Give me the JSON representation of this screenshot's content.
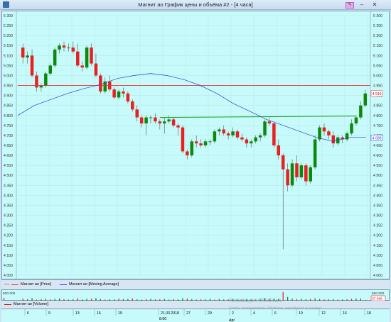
{
  "window": {
    "title": "Магнит ао График цены и объёма #2 - [4 часа]"
  },
  "price_axis": {
    "ticks": [
      "5 300",
      "5 250",
      "5 200",
      "5 150",
      "5 100",
      "5 050",
      "5 000",
      "4 950",
      "4 900",
      "4 850",
      "4 800",
      "4 750",
      "4 700",
      "4 650",
      "4 600",
      "4 550",
      "4 500",
      "4 450",
      "4 400",
      "4 350",
      "4 300",
      "4 250",
      "4 200",
      "4 150",
      "4 100",
      "4 050",
      "4 000"
    ],
    "last_price_label": "4 910",
    "ma_label": "4 688"
  },
  "volume_axis": {
    "top_label": "500 000",
    "bottom_label": "0",
    "last_volume_label": "37 488"
  },
  "legend": {
    "price": "Магнит ао [Price]",
    "ma": "Магнит ао [Moving Average]",
    "volume": "Магнит ао [Volume]"
  },
  "time_axis": {
    "labels": [
      "6",
      "9",
      "13",
      "16",
      "19",
      "21.03.2018",
      "8:00",
      "27",
      "29",
      "2",
      "4",
      "6",
      "10",
      "12",
      "16",
      "18"
    ],
    "month": "Apr"
  },
  "watermark": {
    "line1": "Активация Windows",
    "line2": "Чтобы активировать Windows, перейдите в раздел"
  },
  "chart_data": {
    "type": "candlestick",
    "ylim": [
      4000,
      5300
    ],
    "candles": [
      [
        5140,
        5160,
        5060,
        5090
      ],
      [
        5090,
        5120,
        5060,
        5100
      ],
      [
        5100,
        5130,
        4990,
        5000
      ],
      [
        5000,
        5020,
        4920,
        4940
      ],
      [
        4940,
        4960,
        4920,
        4950
      ],
      [
        4950,
        5020,
        4940,
        5010
      ],
      [
        5010,
        5060,
        5000,
        5050
      ],
      [
        5050,
        5140,
        5040,
        5130
      ],
      [
        5130,
        5160,
        5110,
        5150
      ],
      [
        5150,
        5170,
        5120,
        5140
      ],
      [
        5140,
        5160,
        5120,
        5140
      ],
      [
        5140,
        5170,
        5110,
        5120
      ],
      [
        5120,
        5160,
        5040,
        5050
      ],
      [
        5050,
        5070,
        5020,
        5040
      ],
      [
        5040,
        5150,
        5030,
        5140
      ],
      [
        5140,
        5160,
        5050,
        5060
      ],
      [
        5060,
        5110,
        4990,
        5000
      ],
      [
        5000,
        5010,
        4910,
        4920
      ],
      [
        4920,
        4990,
        4910,
        4970
      ],
      [
        4970,
        5000,
        4920,
        4930
      ],
      [
        4930,
        4940,
        4880,
        4890
      ],
      [
        4890,
        4930,
        4880,
        4920
      ],
      [
        4920,
        4940,
        4890,
        4910
      ],
      [
        4910,
        4920,
        4860,
        4870
      ],
      [
        4870,
        4880,
        4820,
        4830
      ],
      [
        4830,
        4850,
        4770,
        4790
      ],
      [
        4790,
        4800,
        4740,
        4760
      ],
      [
        4760,
        4800,
        4700,
        4790
      ],
      [
        4790,
        4800,
        4760,
        4790
      ],
      [
        4790,
        4810,
        4760,
        4770
      ],
      [
        4770,
        4780,
        4730,
        4760
      ],
      [
        4760,
        4790,
        4710,
        4770
      ],
      [
        4770,
        4800,
        4760,
        4780
      ],
      [
        4780,
        4790,
        4740,
        4750
      ],
      [
        4750,
        4760,
        4700,
        4740
      ],
      [
        4740,
        4750,
        4610,
        4620
      ],
      [
        4620,
        4630,
        4580,
        4600
      ],
      [
        4600,
        4680,
        4590,
        4670
      ],
      [
        4670,
        4700,
        4640,
        4660
      ],
      [
        4660,
        4680,
        4640,
        4650
      ],
      [
        4650,
        4680,
        4640,
        4670
      ],
      [
        4670,
        4680,
        4650,
        4670
      ],
      [
        4670,
        4730,
        4660,
        4720
      ],
      [
        4720,
        4740,
        4700,
        4730
      ],
      [
        4730,
        4750,
        4700,
        4710
      ],
      [
        4710,
        4720,
        4680,
        4700
      ],
      [
        4700,
        4740,
        4690,
        4720
      ],
      [
        4720,
        4730,
        4680,
        4690
      ],
      [
        4690,
        4710,
        4670,
        4680
      ],
      [
        4680,
        4690,
        4640,
        4660
      ],
      [
        4660,
        4680,
        4640,
        4670
      ],
      [
        4670,
        4700,
        4660,
        4690
      ],
      [
        4690,
        4710,
        4670,
        4700
      ],
      [
        4700,
        4780,
        4690,
        4770
      ],
      [
        4770,
        4790,
        4750,
        4760
      ],
      [
        4760,
        4770,
        4640,
        4650
      ],
      [
        4650,
        4680,
        4580,
        4600
      ],
      [
        4600,
        4610,
        4130,
        4530
      ],
      [
        4530,
        4560,
        4420,
        4450
      ],
      [
        4450,
        4580,
        4440,
        4560
      ],
      [
        4560,
        4600,
        4470,
        4490
      ],
      [
        4490,
        4560,
        4480,
        4550
      ],
      [
        4550,
        4560,
        4450,
        4470
      ],
      [
        4470,
        4550,
        4460,
        4540
      ],
      [
        4540,
        4700,
        4530,
        4680
      ],
      [
        4680,
        4750,
        4670,
        4740
      ],
      [
        4740,
        4760,
        4700,
        4720
      ],
      [
        4720,
        4730,
        4680,
        4700
      ],
      [
        4700,
        4720,
        4640,
        4660
      ],
      [
        4660,
        4700,
        4650,
        4690
      ],
      [
        4690,
        4700,
        4660,
        4680
      ],
      [
        4680,
        4720,
        4670,
        4710
      ],
      [
        4710,
        4780,
        4700,
        4760
      ],
      [
        4760,
        4800,
        4750,
        4790
      ],
      [
        4790,
        4870,
        4780,
        4850
      ],
      [
        4850,
        4930,
        4840,
        4910
      ]
    ],
    "moving_average": [
      4800,
      4850,
      4880,
      4910,
      4935,
      4955,
      4985,
      5000,
      5010,
      5000,
      4980,
      4950,
      4910,
      4860,
      4820,
      4780,
      4750,
      4720,
      4690,
      4670,
      4690,
      4690
    ],
    "support_level": 4790,
    "resistance_level": 4950,
    "volumes": [
      120000,
      80000,
      150000,
      60000,
      90000,
      110000,
      70000,
      100000,
      130000,
      90000,
      60000,
      80000,
      140000,
      70000,
      100000,
      110000,
      150000,
      90000,
      60000,
      80000,
      70000,
      120000,
      90000,
      100000,
      130000,
      80000,
      60000,
      90000,
      110000,
      70000,
      80000,
      100000,
      60000,
      90000,
      70000,
      140000,
      120000,
      90000,
      60000,
      80000,
      70000,
      110000,
      60000,
      90000,
      70000,
      80000,
      100000,
      60000,
      70000,
      90000,
      80000,
      60000,
      70000,
      150000,
      90000,
      110000,
      100000,
      480000,
      200000,
      120000,
      90000,
      110000,
      80000,
      100000,
      130000,
      90000,
      70000,
      80000,
      90000,
      60000,
      70000,
      80000,
      100000,
      120000,
      130000,
      37488
    ]
  }
}
